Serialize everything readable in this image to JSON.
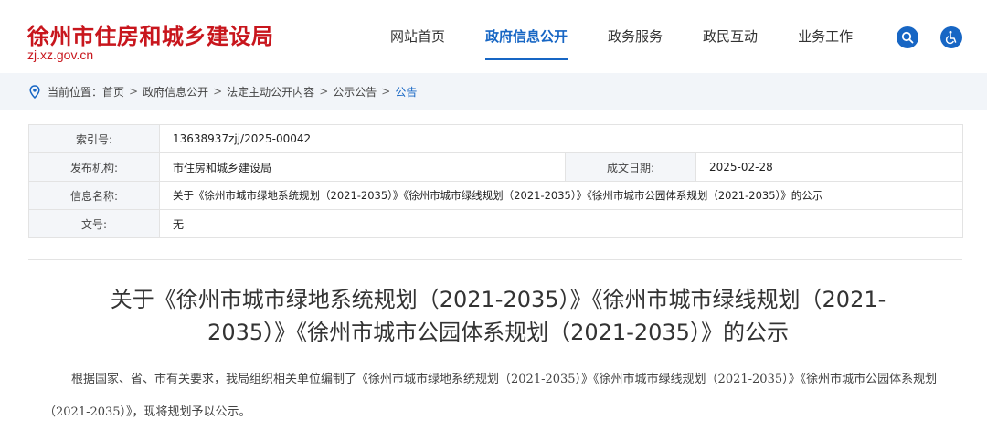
{
  "header": {
    "site_title": "徐州市住房和城乡建设局",
    "site_url": "zj.xz.gov.cn",
    "nav": [
      {
        "label": "网站首页",
        "active": false
      },
      {
        "label": "政府信息公开",
        "active": true
      },
      {
        "label": "政务服务",
        "active": false
      },
      {
        "label": "政民互动",
        "active": false
      },
      {
        "label": "业务工作",
        "active": false
      }
    ],
    "search_icon": "search-icon",
    "accessibility_icon": "wheelchair-icon",
    "accent_color": "#1766c4",
    "brand_color": "#c8161d"
  },
  "breadcrumb": {
    "prefix": "当前位置：",
    "items": [
      "首页",
      "政府信息公开",
      "法定主动公开内容",
      "公示公告"
    ],
    "current": "公告",
    "separator": ">"
  },
  "info": {
    "index_label": "索引号:",
    "index_value": "13638937zjj/2025-00042",
    "publisher_label": "发布机构:",
    "publisher_value": "市住房和城乡建设局",
    "date_label": "成文日期:",
    "date_value": "2025-02-28",
    "name_label": "信息名称:",
    "name_value": "关于《徐州市城市绿地系统规划（2021-2035）》《徐州市城市绿线规划（2021-2035）》《徐州市城市公园体系规划（2021-2035）》的公示",
    "doc_no_label": "文号:",
    "doc_no_value": "无"
  },
  "article": {
    "title": "关于《徐州市城市绿地系统规划（2021-2035）》《徐州市城市绿线规划（2021-2035）》《徐州市城市公园体系规划（2021-2035）》的公示",
    "body": "根据国家、省、市有关要求，我局组织相关单位编制了《徐州市城市绿地系统规划（2021-2035）》《徐州市城市绿线规划（2021-2035）》《徐州市城市公园体系规划（2021-2035）》，现将规划予以公示。"
  }
}
